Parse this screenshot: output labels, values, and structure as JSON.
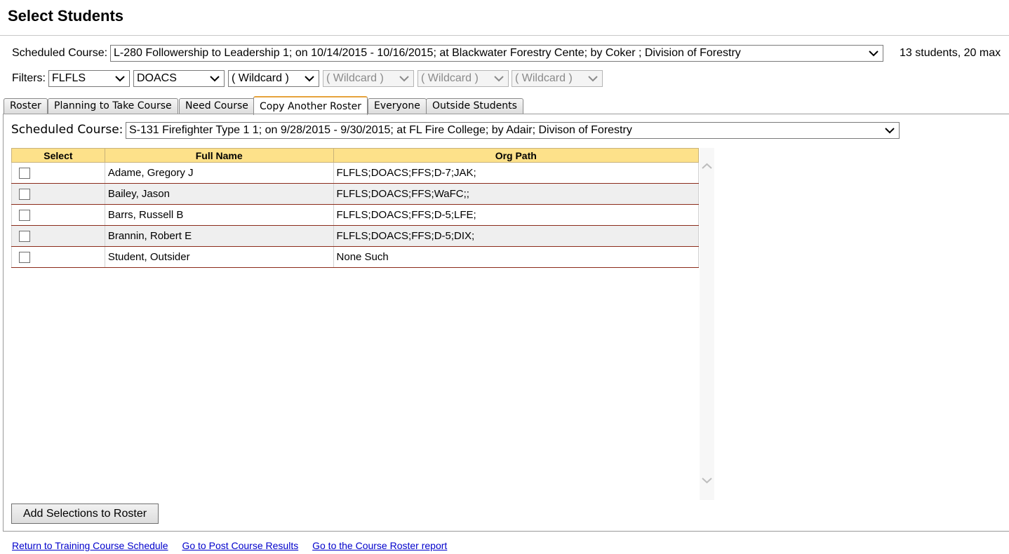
{
  "page": {
    "title": "Select Students"
  },
  "scheduled_course": {
    "label": "Scheduled Course:",
    "selected": "L-280 Followership to Leadership 1; on 10/14/2015 - 10/16/2015; at Blackwater Forestry Cente; by Coker ; Division of Forestry",
    "capacity": "13 students, 20 max"
  },
  "filters": {
    "label": "Filters:",
    "selects": [
      {
        "value": "FLFLS",
        "disabled": false
      },
      {
        "value": "DOACS",
        "disabled": false
      },
      {
        "value": "( Wildcard )",
        "disabled": false
      },
      {
        "value": "( Wildcard )",
        "disabled": true
      },
      {
        "value": "( Wildcard )",
        "disabled": true
      },
      {
        "value": "( Wildcard )",
        "disabled": true
      }
    ]
  },
  "tabs": [
    {
      "label": "Roster"
    },
    {
      "label": "Planning to Take Course"
    },
    {
      "label": "Need Course"
    },
    {
      "label": "Copy Another Roster",
      "active": true
    },
    {
      "label": "Everyone"
    },
    {
      "label": "Outside Students"
    }
  ],
  "copy_roster": {
    "course_label": "Scheduled Course:",
    "course_selected": "S-131 Firefighter Type 1 1; on 9/28/2015 - 9/30/2015; at FL Fire College; by Adair; Divison of Forestry"
  },
  "table": {
    "headers": [
      "Select",
      "Full Name",
      "Org Path"
    ],
    "rows": [
      {
        "name": "Adame, Gregory J",
        "org": "FLFLS;DOACS;FFS;D-7;JAK;",
        "checked": false
      },
      {
        "name": "Bailey, Jason",
        "org": "FLFLS;DOACS;FFS;WaFC;;",
        "checked": false
      },
      {
        "name": "Barrs, Russell B",
        "org": "FLFLS;DOACS;FFS;D-5;LFE;",
        "checked": false
      },
      {
        "name": "Brannin, Robert E",
        "org": "FLFLS;DOACS;FFS;D-5;DIX;",
        "checked": false
      },
      {
        "name": "Student, Outsider",
        "org": "None Such",
        "checked": false
      }
    ]
  },
  "actions": {
    "add_button": "Add Selections to Roster"
  },
  "footer_links": [
    "Return to Training Course Schedule",
    "Go to Post Course Results",
    "Go to the Course Roster report"
  ],
  "icons": {
    "dropdown": "chevron-down-icon",
    "scroll_up": "chevron-up-icon",
    "scroll_down": "chevron-down-icon"
  }
}
